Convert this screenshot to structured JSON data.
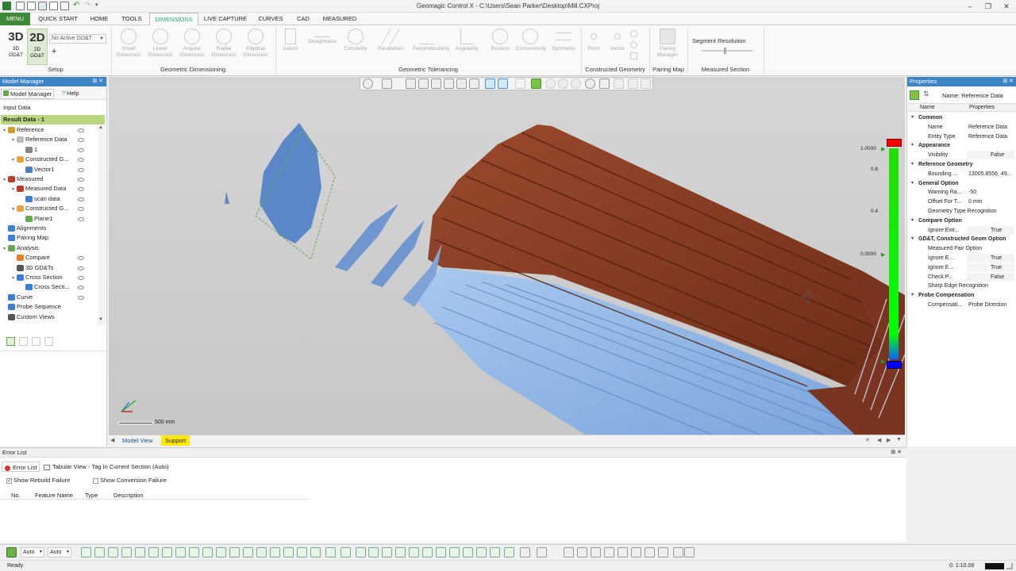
{
  "window": {
    "title": "Geomagic Control X - C:\\Users\\Sean Parker\\Desktop\\Mill.CXProj",
    "controls": [
      "–",
      "❐",
      "✕"
    ]
  },
  "menu_tabs": [
    "MENU",
    "QUICK START",
    "HOME",
    "TOOLS",
    "DIMENSIONS",
    "LIVE CAPTURE",
    "CURVES",
    "CAD",
    "MEASURED"
  ],
  "ribbon": {
    "setup": {
      "b3d_big": "3D",
      "b3d_small": "3D GD&T",
      "b2d_big": "2D",
      "b2d_small": "2D GD&T",
      "gdt_select": "No Active GD&T",
      "label": "Setup"
    },
    "geometric_dimensioning": {
      "label": "Geometric Dimensioning",
      "buttons": [
        "Smart Dimension",
        "Linear Dimension",
        "Angular Dimension",
        "Radial Dimension",
        "Elliptical Dimension"
      ]
    },
    "geometric_tolerancing": {
      "label": "Geometric Tolerancing",
      "buttons": [
        "Datum",
        "Straightness",
        "Circularity",
        "Parallelism",
        "Perpendicularity",
        "Angularity",
        "Position",
        "Concentricity",
        "Symmetry"
      ]
    },
    "constructed_geometry": {
      "label": "Constructed Geometry",
      "buttons": [
        "Point",
        "Vector"
      ]
    },
    "pairing_map": {
      "label": "Pairing Map",
      "buttons": [
        "Pairing Manager"
      ]
    },
    "measured_section": {
      "label": "Measured Section",
      "title": "Segment Resolution"
    }
  },
  "model_manager": {
    "title": "Model Manager",
    "tabs": [
      "Model Manager",
      "Help"
    ],
    "input_data": "Input Data",
    "result_data": "Result Data - 1",
    "tree": [
      {
        "label": "Reference",
        "level": 0,
        "color": "#c9a227"
      },
      {
        "label": "Reference Data",
        "level": 1,
        "color": "#bbbbbb"
      },
      {
        "label": "1",
        "level": 2,
        "color": "#888888"
      },
      {
        "label": "Constructed G...",
        "level": 1,
        "color": "#e3a640"
      },
      {
        "label": "Vector1",
        "level": 2,
        "color": "#4a7fc1"
      },
      {
        "label": "Measured",
        "level": 0,
        "color": "#c0392b"
      },
      {
        "label": "Measured Data",
        "level": 1,
        "color": "#c0392b"
      },
      {
        "label": "scan data",
        "level": 2,
        "color": "#3b7dd8"
      },
      {
        "label": "Constructed G...",
        "level": 1,
        "color": "#e3a640"
      },
      {
        "label": "Plane1",
        "level": 2,
        "color": "#6aa84f"
      },
      {
        "label": "Alignments",
        "level": 0,
        "color": "#3b7dd8"
      },
      {
        "label": "Pairing Map",
        "level": 0,
        "color": "#3b7dd8"
      },
      {
        "label": "Analysis",
        "level": 0,
        "color": "#6aa84f"
      },
      {
        "label": "Compare",
        "level": 1,
        "color": "#e67e22"
      },
      {
        "label": "3D GD&Ts",
        "level": 1,
        "color": "#555555"
      },
      {
        "label": "Cross Section",
        "level": 1,
        "color": "#3b7dd8"
      },
      {
        "label": "Cross Secti...",
        "level": 2,
        "color": "#3b7dd8"
      },
      {
        "label": "Curve",
        "level": 0,
        "color": "#3b7dd8"
      },
      {
        "label": "Probe Sequence",
        "level": 0,
        "color": "#3b7dd8"
      },
      {
        "label": "Custom Views",
        "level": 0,
        "color": "#555555"
      }
    ]
  },
  "viewport": {
    "scale_label": "500 mm",
    "color_scale": {
      "labels": [
        "1.0000",
        "0.8",
        "0.4",
        "0.0000"
      ],
      "colors": [
        "#ff0000",
        "#00ff00",
        "#0000ff"
      ]
    },
    "bottom_tabs": [
      "Model View",
      "Support"
    ]
  },
  "properties": {
    "title": "Properties",
    "name_header": "Name: Reference Data",
    "col_name": "Name",
    "col_props": "Properties",
    "rows": [
      {
        "cat": true,
        "name": "Common"
      },
      {
        "name": "Name",
        "value": "Reference Data"
      },
      {
        "name": "Entity Type",
        "value": "Reference Data"
      },
      {
        "cat": true,
        "name": "Appearance"
      },
      {
        "name": "Visibility",
        "value": "False"
      },
      {
        "cat": true,
        "name": "Reference Geometry"
      },
      {
        "name": "Bounding ...",
        "value": "13005.8556, 49..."
      },
      {
        "cat": true,
        "name": "General Option"
      },
      {
        "name": "Warning Ra...",
        "value": "-50"
      },
      {
        "name": "Offset For T...",
        "value": "0 mm"
      },
      {
        "name": "Geometry Type Recognition",
        "value": ""
      },
      {
        "cat": true,
        "name": "Compare Option"
      },
      {
        "name": "Ignore Extr...",
        "value": "True"
      },
      {
        "cat": true,
        "name": "GD&T, Constructed Geom Option"
      },
      {
        "name": "Measured Pair Option",
        "value": ""
      },
      {
        "name": "Ignore E...",
        "value": "True"
      },
      {
        "name": "Ignore E...",
        "value": "True"
      },
      {
        "name": "Check P...",
        "value": "False"
      },
      {
        "name": "Sharp Edge Recognition",
        "value": ""
      },
      {
        "cat": true,
        "name": "Probe Compensation"
      },
      {
        "name": "Compensati...",
        "value": "Probe Direction"
      }
    ]
  },
  "error_list": {
    "title": "Error List",
    "tabs": [
      "Error List",
      "Tabular View - Tag In Current Section (Auto)"
    ],
    "show_rebuild": "Show Rebuild Failure",
    "show_conversion": "Show Conversion Failure",
    "columns": [
      "No.",
      "Feature Name",
      "Type",
      "Description"
    ]
  },
  "bottom_toolbar": {
    "select1": "Auto",
    "select2": "Auto"
  },
  "status": {
    "left": "Ready",
    "time": "0: 1:10.09"
  }
}
